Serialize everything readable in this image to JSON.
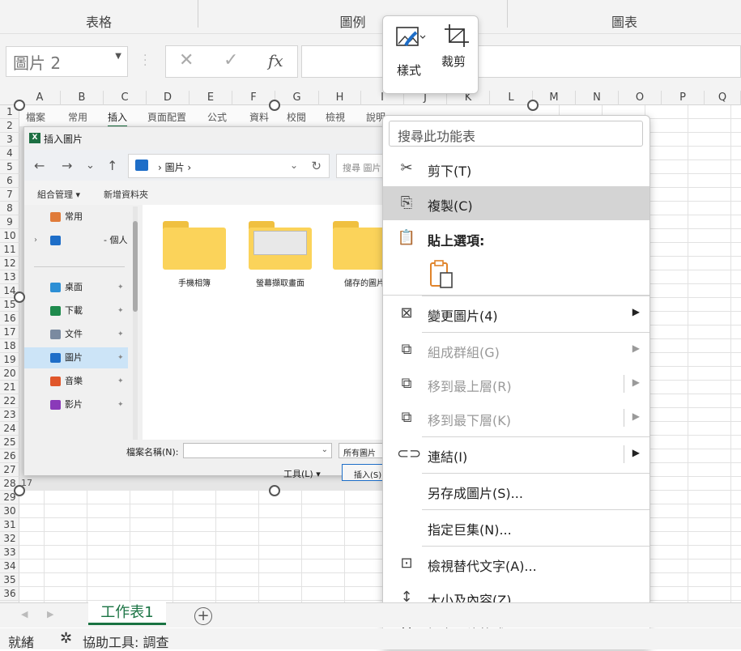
{
  "ribbon": {
    "groups": [
      "表格",
      "圖例",
      "圖表"
    ]
  },
  "formula_bar": {
    "name_box": "圖片 2",
    "cancel": "✕",
    "enter": "✓",
    "fx": "fx"
  },
  "columns": [
    "A",
    "B",
    "C",
    "D",
    "E",
    "F",
    "G",
    "H",
    "I",
    "J",
    "K",
    "L",
    "M",
    "N",
    "O",
    "P",
    "Q"
  ],
  "rows": [
    "1",
    "2",
    "3",
    "4",
    "5",
    "6",
    "7",
    "8",
    "9",
    "10",
    "11",
    "12",
    "13",
    "14",
    "15",
    "16",
    "17",
    "18",
    "19",
    "20",
    "21",
    "22",
    "23",
    "24",
    "25",
    "26",
    "27",
    "28",
    "29",
    "30",
    "31",
    "32",
    "33",
    "34",
    "35",
    "36"
  ],
  "picture": {
    "menu": [
      "檔案",
      "常用",
      "插入",
      "頁面配置",
      "公式",
      "資料",
      "校閱",
      "檢視",
      "說明"
    ],
    "menu_active": "插入",
    "row_label": "17",
    "dialog": {
      "title": "插入圖片",
      "xl_badge": "X",
      "nav": {
        "back": "←",
        "forward": "→",
        "down": "⌄",
        "up": "↑"
      },
      "address": "›  圖片  ›",
      "search_placeholder": "搜尋 圖片",
      "organize": "組合管理 ▾",
      "new_folder": "新增資料夾",
      "nav_items": [
        {
          "label": "常用",
          "color": "#e07b39"
        },
        {
          "label": "- 個人",
          "color": "#1e6ec8"
        },
        {
          "label": "桌面",
          "color": "#2d8fd5"
        },
        {
          "label": "下載",
          "color": "#1e8a4c"
        },
        {
          "label": "文件",
          "color": "#7a8aa0"
        },
        {
          "label": "圖片",
          "color": "#1e6ec8"
        },
        {
          "label": "音樂",
          "color": "#e0562a"
        },
        {
          "label": "影片",
          "color": "#8a3ab9"
        }
      ],
      "folders": [
        "手機相簿",
        "螢幕擷取畫面",
        "儲存的圖片"
      ],
      "filename_label": "檔案名稱(N):",
      "filetype": "所有圖片",
      "tools": "工具(L)  ▾",
      "insert": "插入(S)"
    }
  },
  "image_popup": {
    "style_label": "樣式",
    "crop_label": "裁剪"
  },
  "context_menu": {
    "search_placeholder": "搜尋此功能表",
    "items": [
      {
        "label": "剪下(T)",
        "icon": "scissors-icon"
      },
      {
        "label": "複製(C)",
        "icon": "copy-icon"
      },
      {
        "label": "貼上選項:",
        "icon": "paste-icon"
      },
      {
        "label": "變更圖片(4)",
        "icon": "change-picture-icon"
      },
      {
        "label": "組成群組(G)",
        "icon": "group-icon"
      },
      {
        "label": "移到最上層(R)",
        "icon": "bring-front-icon"
      },
      {
        "label": "移到最下層(K)",
        "icon": "send-back-icon"
      },
      {
        "label": "連結(I)",
        "icon": "link-icon"
      },
      {
        "label": "另存成圖片(S)...",
        "icon": ""
      },
      {
        "label": "指定巨集(N)...",
        "icon": ""
      },
      {
        "label": "檢視替代文字(A)...",
        "icon": "alt-text-icon"
      },
      {
        "label": "大小及內容(Z)...",
        "icon": "size-icon"
      },
      {
        "label": "設定圖片格式(O)...",
        "icon": "format-picture-icon"
      }
    ]
  },
  "sheet_tabs": {
    "active": "工作表1",
    "add": "+",
    "prev": "◀",
    "next": "▶"
  },
  "status_bar": {
    "ready": "就緒",
    "accessibility": "協助工具: 調查"
  }
}
